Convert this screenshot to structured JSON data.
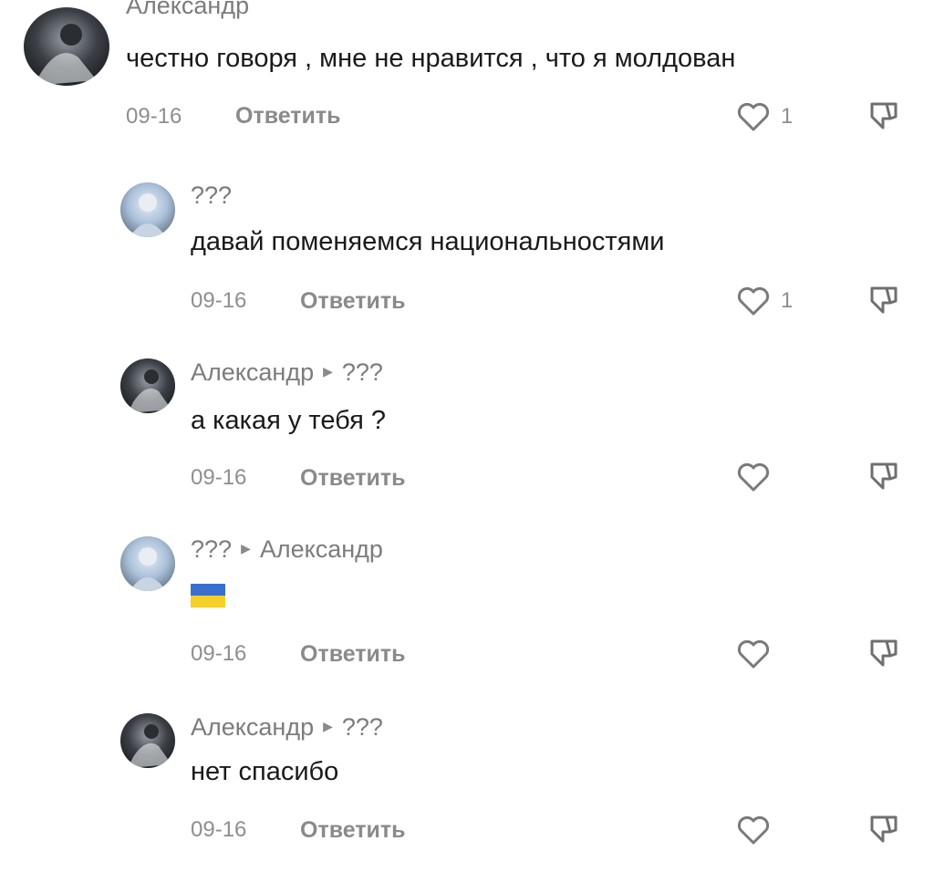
{
  "comments": [
    {
      "author": "Александр",
      "text": "честно говоря , мне не нравится , что я молдован",
      "date": "09-16",
      "reply_label": "Ответить",
      "likes": "1"
    },
    {
      "author": "???",
      "text": "давай поменяемся национальностями",
      "date": "09-16",
      "reply_label": "Ответить",
      "likes": "1"
    },
    {
      "author": "Александр",
      "reply_to": "???",
      "text": "а какая у тебя ?",
      "date": "09-16",
      "reply_label": "Ответить"
    },
    {
      "author": "???",
      "reply_to": "Александр",
      "text": "",
      "emoji": "flag-ukraine",
      "date": "09-16",
      "reply_label": "Ответить"
    },
    {
      "author": "Александр",
      "reply_to": "???",
      "text": "нет спасибо",
      "date": "09-16",
      "reply_label": "Ответить"
    }
  ],
  "colors": {
    "flag_blue": "#3a6fd0",
    "flag_yellow": "#f5cf2a"
  }
}
